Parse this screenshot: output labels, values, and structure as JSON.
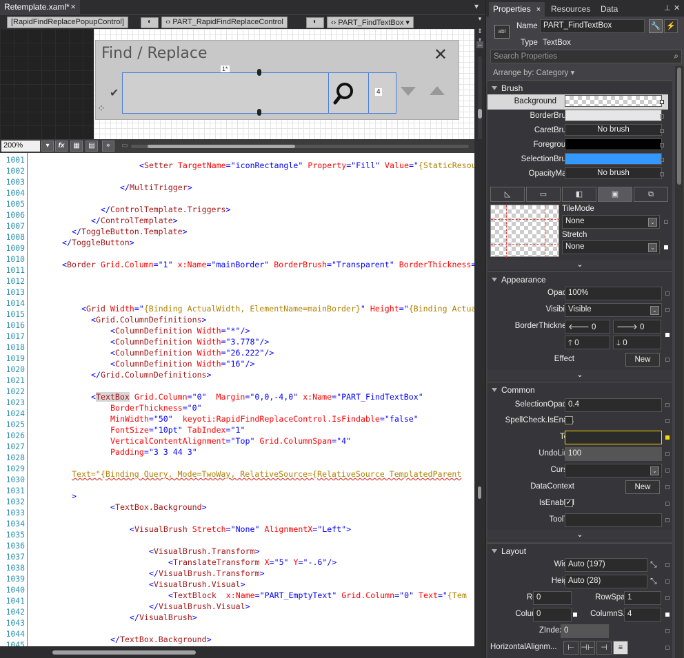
{
  "document_tab": {
    "title": "Retemplate.xaml*",
    "close": "×"
  },
  "breadcrumbs": [
    {
      "label": "[RapidFindReplacePopupControl]"
    },
    {
      "label": "PART_RapidFindReplaceControl"
    },
    {
      "label": "PART_FindTextBox ▾"
    }
  ],
  "designer": {
    "dialog_title": "Find / Replace",
    "close_glyph": "✕",
    "small_marker": "1*",
    "count_marker": "4"
  },
  "designer_toolbar": {
    "zoom": "200%",
    "fx": "fx"
  },
  "code": {
    "lines": [
      {
        "n": "1001",
        "indent": 22,
        "parts": [
          [
            "br",
            "<"
          ],
          [
            "tag",
            "Setter"
          ],
          [
            "attr",
            " TargetName"
          ],
          [
            "br",
            "=\""
          ],
          [
            "val",
            "iconRectangle"
          ],
          [
            "br",
            "\""
          ],
          [
            "attr",
            " Property"
          ],
          [
            "br",
            "=\""
          ],
          [
            "val",
            "Fill"
          ],
          [
            "br",
            "\""
          ],
          [
            "attr",
            " Value"
          ],
          [
            "br",
            "=\""
          ],
          [
            "bind",
            "{StaticResource"
          ]
        ]
      },
      {
        "n": "1002",
        "indent": 0,
        "parts": []
      },
      {
        "n": "1003",
        "indent": 18,
        "parts": [
          [
            "br",
            "</"
          ],
          [
            "tag",
            "MultiTrigger"
          ],
          [
            "br",
            ">"
          ]
        ]
      },
      {
        "n": "1004",
        "indent": 0,
        "parts": []
      },
      {
        "n": "1005",
        "indent": 14,
        "parts": [
          [
            "br",
            "</"
          ],
          [
            "tag",
            "ControlTemplate.Triggers"
          ],
          [
            "br",
            ">"
          ]
        ]
      },
      {
        "n": "1006",
        "indent": 12,
        "parts": [
          [
            "br",
            "</"
          ],
          [
            "tag",
            "ControlTemplate"
          ],
          [
            "br",
            ">"
          ]
        ]
      },
      {
        "n": "1007",
        "indent": 8,
        "parts": [
          [
            "br",
            "</"
          ],
          [
            "tag",
            "ToggleButton.Template"
          ],
          [
            "br",
            ">"
          ]
        ]
      },
      {
        "n": "1008",
        "indent": 6,
        "parts": [
          [
            "br",
            "</"
          ],
          [
            "tag",
            "ToggleButton"
          ],
          [
            "br",
            ">"
          ]
        ]
      },
      {
        "n": "1009",
        "indent": 0,
        "parts": []
      },
      {
        "n": "1010",
        "indent": 6,
        "parts": [
          [
            "br",
            "<"
          ],
          [
            "tag",
            "Border"
          ],
          [
            "attr",
            " Grid.Column"
          ],
          [
            "br",
            "=\""
          ],
          [
            "val",
            "1"
          ],
          [
            "br",
            "\""
          ],
          [
            "attr",
            " x:Name"
          ],
          [
            "br",
            "=\""
          ],
          [
            "val",
            "mainBorder"
          ],
          [
            "br",
            "\""
          ],
          [
            "attr",
            " BorderBrush"
          ],
          [
            "br",
            "=\""
          ],
          [
            "val",
            "Transparent"
          ],
          [
            "br",
            "\""
          ],
          [
            "attr",
            " BorderThickness"
          ],
          [
            "br",
            "="
          ]
        ]
      },
      {
        "n": "1011",
        "indent": 0,
        "parts": []
      },
      {
        "n": "1012",
        "indent": 0,
        "parts": []
      },
      {
        "n": "1013",
        "indent": 0,
        "parts": []
      },
      {
        "n": "1014",
        "indent": 10,
        "parts": [
          [
            "br",
            "<"
          ],
          [
            "tag",
            "Grid"
          ],
          [
            "attr",
            " Width"
          ],
          [
            "br",
            "=\""
          ],
          [
            "bind",
            "{Binding ActualWidth, ElementName=mainBorder}"
          ],
          [
            "br",
            "\""
          ],
          [
            "attr",
            " Height"
          ],
          [
            "br",
            "=\""
          ],
          [
            "bind",
            "{Binding Actua"
          ]
        ]
      },
      {
        "n": "1015",
        "indent": 12,
        "parts": [
          [
            "br",
            "<"
          ],
          [
            "tag",
            "Grid.ColumnDefinitions"
          ],
          [
            "br",
            ">"
          ]
        ]
      },
      {
        "n": "1016",
        "indent": 16,
        "parts": [
          [
            "br",
            "<"
          ],
          [
            "tag",
            "ColumnDefinition"
          ],
          [
            "attr",
            " Width"
          ],
          [
            "br",
            "=\""
          ],
          [
            "val",
            "*"
          ],
          [
            "br",
            "\"/>"
          ]
        ]
      },
      {
        "n": "1017",
        "indent": 16,
        "parts": [
          [
            "br",
            "<"
          ],
          [
            "tag",
            "ColumnDefinition"
          ],
          [
            "attr",
            " Width"
          ],
          [
            "br",
            "=\""
          ],
          [
            "val",
            "3.778"
          ],
          [
            "br",
            "\"/>"
          ]
        ]
      },
      {
        "n": "1018",
        "indent": 16,
        "parts": [
          [
            "br",
            "<"
          ],
          [
            "tag",
            "ColumnDefinition"
          ],
          [
            "attr",
            " Width"
          ],
          [
            "br",
            "=\""
          ],
          [
            "val",
            "26.222"
          ],
          [
            "br",
            "\"/>"
          ]
        ]
      },
      {
        "n": "1019",
        "indent": 16,
        "parts": [
          [
            "br",
            "<"
          ],
          [
            "tag",
            "ColumnDefinition"
          ],
          [
            "attr",
            " Width"
          ],
          [
            "br",
            "=\""
          ],
          [
            "val",
            "16"
          ],
          [
            "br",
            "\"/>"
          ]
        ]
      },
      {
        "n": "1020",
        "indent": 12,
        "parts": [
          [
            "br",
            "</"
          ],
          [
            "tag",
            "Grid.ColumnDefinitions"
          ],
          [
            "br",
            ">"
          ]
        ]
      },
      {
        "n": "1021",
        "indent": 0,
        "parts": []
      },
      {
        "n": "1022",
        "indent": 12,
        "parts": [
          [
            "br",
            "<"
          ],
          [
            "hl",
            "TextBox"
          ],
          [
            "attr",
            " Grid.Column"
          ],
          [
            "br",
            "=\""
          ],
          [
            "val",
            "0"
          ],
          [
            "br",
            "\"  "
          ],
          [
            "attr",
            "Margin"
          ],
          [
            "br",
            "=\""
          ],
          [
            "val",
            "0,0,-4,0"
          ],
          [
            "br",
            "\""
          ],
          [
            "attr",
            " x:Name"
          ],
          [
            "br",
            "=\""
          ],
          [
            "val",
            "PART_FindTextBox"
          ],
          [
            "br",
            "\""
          ]
        ]
      },
      {
        "n": "1023",
        "indent": 16,
        "parts": [
          [
            "attr",
            "BorderThickness"
          ],
          [
            "br",
            "=\""
          ],
          [
            "val",
            "0"
          ],
          [
            "br",
            "\""
          ]
        ]
      },
      {
        "n": "1024",
        "indent": 16,
        "parts": [
          [
            "attr",
            "MinWidth"
          ],
          [
            "br",
            "=\""
          ],
          [
            "val",
            "50"
          ],
          [
            "br",
            "\"  "
          ],
          [
            "attr",
            "keyoti:RapidFindReplaceControl.IsFindable"
          ],
          [
            "br",
            "=\""
          ],
          [
            "val",
            "false"
          ],
          [
            "br",
            "\""
          ]
        ]
      },
      {
        "n": "1025",
        "indent": 16,
        "parts": [
          [
            "attr",
            "FontSize"
          ],
          [
            "br",
            "=\""
          ],
          [
            "val",
            "10pt"
          ],
          [
            "br",
            "\""
          ],
          [
            "attr",
            " TabIndex"
          ],
          [
            "br",
            "=\""
          ],
          [
            "val",
            "1"
          ],
          [
            "br",
            "\""
          ]
        ]
      },
      {
        "n": "1026",
        "indent": 16,
        "parts": [
          [
            "attr",
            "VerticalContentAlignment"
          ],
          [
            "br",
            "=\""
          ],
          [
            "val",
            "Top"
          ],
          [
            "br",
            "\""
          ],
          [
            "attr",
            " Grid.ColumnSpan"
          ],
          [
            "br",
            "=\""
          ],
          [
            "val",
            "4"
          ],
          [
            "br",
            "\""
          ]
        ]
      },
      {
        "n": "1027",
        "indent": 16,
        "parts": [
          [
            "attr",
            "Padding"
          ],
          [
            "br",
            "=\""
          ],
          [
            "val",
            "3 3 44 3"
          ],
          [
            "br",
            "\""
          ]
        ]
      },
      {
        "n": "1028",
        "indent": 0,
        "parts": []
      },
      {
        "n": "1029",
        "indent": 8,
        "parts": [
          [
            "sq",
            "Text=\"{Binding Query, Mode=TwoWay, RelativeSource={RelativeSource TemplatedParent"
          ]
        ]
      },
      {
        "n": "1030",
        "indent": 0,
        "parts": []
      },
      {
        "n": "1031",
        "indent": 8,
        "parts": [
          [
            "br",
            ">"
          ]
        ]
      },
      {
        "n": "1032",
        "indent": 16,
        "parts": [
          [
            "br",
            "<"
          ],
          [
            "tag",
            "TextBox.Background"
          ],
          [
            "br",
            ">"
          ]
        ]
      },
      {
        "n": "1033",
        "indent": 0,
        "parts": []
      },
      {
        "n": "1034",
        "indent": 20,
        "parts": [
          [
            "br",
            "<"
          ],
          [
            "tag",
            "VisualBrush"
          ],
          [
            "attr",
            " Stretch"
          ],
          [
            "br",
            "=\""
          ],
          [
            "val",
            "None"
          ],
          [
            "br",
            "\""
          ],
          [
            "attr",
            " AlignmentX"
          ],
          [
            "br",
            "=\""
          ],
          [
            "val",
            "Left"
          ],
          [
            "br",
            "\">"
          ]
        ]
      },
      {
        "n": "1035",
        "indent": 0,
        "parts": []
      },
      {
        "n": "1036",
        "indent": 24,
        "parts": [
          [
            "br",
            "<"
          ],
          [
            "tag",
            "VisualBrush.Transform"
          ],
          [
            "br",
            ">"
          ]
        ]
      },
      {
        "n": "1037",
        "indent": 28,
        "parts": [
          [
            "br",
            "<"
          ],
          [
            "tag",
            "TranslateTransform"
          ],
          [
            "attr",
            " X"
          ],
          [
            "br",
            "=\""
          ],
          [
            "val",
            "5"
          ],
          [
            "br",
            "\""
          ],
          [
            "attr",
            " Y"
          ],
          [
            "br",
            "=\""
          ],
          [
            "val",
            "-.6"
          ],
          [
            "br",
            "\"/>"
          ]
        ]
      },
      {
        "n": "1038",
        "indent": 24,
        "parts": [
          [
            "br",
            "</"
          ],
          [
            "tag",
            "VisualBrush.Transform"
          ],
          [
            "br",
            ">"
          ]
        ]
      },
      {
        "n": "1039",
        "indent": 24,
        "parts": [
          [
            "br",
            "<"
          ],
          [
            "tag",
            "VisualBrush.Visual"
          ],
          [
            "br",
            ">"
          ]
        ]
      },
      {
        "n": "1040",
        "indent": 28,
        "parts": [
          [
            "br",
            "<"
          ],
          [
            "tag",
            "TextBlock"
          ],
          [
            "attr",
            "  x:Name"
          ],
          [
            "br",
            "=\""
          ],
          [
            "val",
            "PART_EmptyText"
          ],
          [
            "br",
            "\""
          ],
          [
            "attr",
            " Grid.Column"
          ],
          [
            "br",
            "=\""
          ],
          [
            "val",
            "0"
          ],
          [
            "br",
            "\""
          ],
          [
            "attr",
            " Text"
          ],
          [
            "br",
            "=\""
          ],
          [
            "bind",
            "{Tem"
          ]
        ]
      },
      {
        "n": "1041",
        "indent": 24,
        "parts": [
          [
            "br",
            "</"
          ],
          [
            "tag",
            "VisualBrush.Visual"
          ],
          [
            "br",
            ">"
          ]
        ]
      },
      {
        "n": "1042",
        "indent": 20,
        "parts": [
          [
            "br",
            "</"
          ],
          [
            "tag",
            "VisualBrush"
          ],
          [
            "br",
            ">"
          ]
        ]
      },
      {
        "n": "1043",
        "indent": 0,
        "parts": []
      },
      {
        "n": "1044",
        "indent": 16,
        "parts": [
          [
            "br",
            "</"
          ],
          [
            "tag",
            "TextBox.Background"
          ],
          [
            "br",
            ">"
          ]
        ]
      }
    ],
    "line_numbers": [
      "1001",
      "1002",
      "1003",
      "1004",
      "1005",
      "1006",
      "1007",
      "1008",
      "1009",
      "1010",
      "1011",
      "1012",
      "1013",
      "1014",
      "1015",
      "1016",
      "1017",
      "1018",
      "1019",
      "1020",
      "1021",
      "1022",
      "1023",
      "1024",
      "1025",
      "1026",
      "1027",
      "1028",
      "1029",
      "1030",
      "1031",
      "1032",
      "1033",
      "1034",
      "1035",
      "1036",
      "1037",
      "1038",
      "1039",
      "1040",
      "1041",
      "1042",
      "1043",
      "1044",
      "1045"
    ]
  },
  "properties": {
    "tabs": [
      {
        "label": "Properties",
        "close": "×"
      },
      {
        "label": "Resources"
      },
      {
        "label": "Data"
      }
    ],
    "name_label": "Name",
    "name_value": "PART_FindTextBox",
    "type_label": "Type",
    "type_value": "TextBox",
    "search_placeholder": "Search Properties",
    "arrange_by": "Arrange by: Category ▾",
    "brush": {
      "title": "Brush",
      "rows": [
        {
          "label": "Background",
          "value": "",
          "swatch": "checker"
        },
        {
          "label": "BorderBrush",
          "value": "",
          "swatch": "#e6e6e6"
        },
        {
          "label": "CaretBrush",
          "value": "No brush",
          "swatch": "none"
        },
        {
          "label": "Foreground",
          "value": "",
          "swatch": "#000000"
        },
        {
          "label": "SelectionBrush",
          "value": "",
          "swatch": "#3399ff"
        },
        {
          "label": "OpacityMask",
          "value": "No brush",
          "swatch": "none"
        }
      ],
      "tilemode_label": "TileMode",
      "tilemode_value": "None",
      "stretch_label": "Stretch",
      "stretch_value": "None"
    },
    "appearance": {
      "title": "Appearance",
      "opacity_label": "Opacity",
      "opacity_value": "100%",
      "visibility_label": "Visibility",
      "visibility_value": "Visible",
      "borderthickness_label": "BorderThickness",
      "bt_left": "0",
      "bt_right": "0",
      "bt_top": "0",
      "bt_bottom": "0",
      "effect_label": "Effect",
      "new_label": "New"
    },
    "common": {
      "title": "Common",
      "selectionopacity_label": "SelectionOpacity",
      "selectionopacity_value": "0.4",
      "spellcheck_label": "SpellCheck.IsEna...",
      "text_label": "Text",
      "text_value": "",
      "undolimit_label": "UndoLimit",
      "undolimit_value": "100",
      "cursor_label": "Cursor",
      "cursor_value": "",
      "datacontext_label": "DataContext",
      "new_label": "New",
      "isenabled_label": "IsEnabled",
      "tooltip_label": "ToolTip",
      "tooltip_value": ""
    },
    "layout": {
      "title": "Layout",
      "width_label": "Width",
      "width_value": "Auto (197)",
      "height_label": "Height",
      "height_value": "Auto (28)",
      "row_label": "Row",
      "row_value": "0",
      "rowspan_label": "RowSpan",
      "rowspan_value": "1",
      "column_label": "Column",
      "column_value": "0",
      "columnspan_label": "ColumnS...",
      "columnspan_value": "4",
      "zindex_label": "ZIndex",
      "zindex_value": "0",
      "horiz_label": "HorizontalAlignm..."
    },
    "colors": {
      "selected_row": "#d8d8d8",
      "selection_brush": "#3399ff",
      "text_field_border": "#ffd800"
    }
  }
}
